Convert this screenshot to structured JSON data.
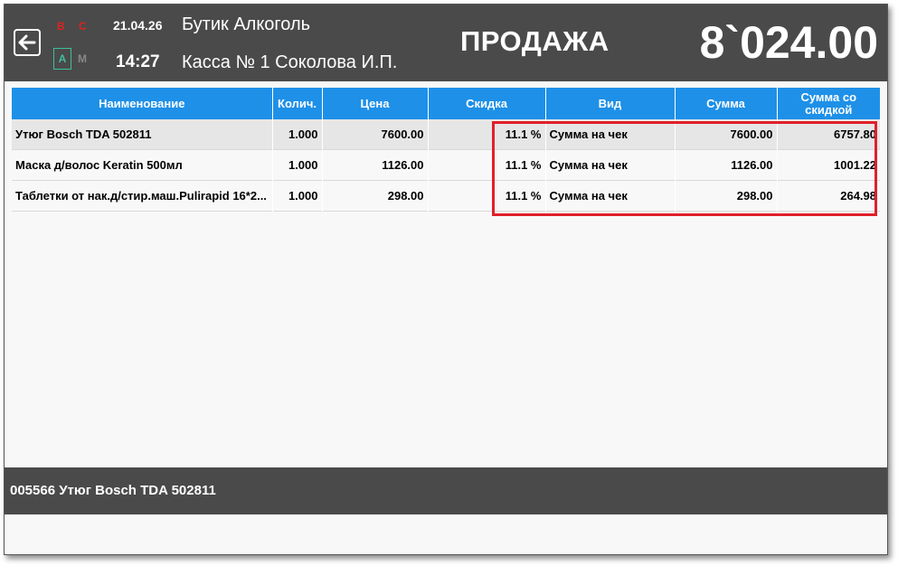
{
  "header": {
    "flags": {
      "b": "B",
      "c": "C",
      "a": "A",
      "m": "M"
    },
    "date": "21.04.26",
    "time": "14:27",
    "shop_name": "Бутик Алкоголь",
    "register": "Касса № 1 Соколова И.П.",
    "mode": "ПРОДАЖА",
    "total": "8`024.00"
  },
  "table": {
    "columns": [
      "Наименование",
      "Колич.",
      "Цена",
      "Скидка",
      "Вид",
      "Сумма",
      "Сумма со скидкой"
    ],
    "rows": [
      {
        "name": "Утюг Bosch TDA 502811",
        "qty": "1.000",
        "price": "7600.00",
        "discount": "11.1 %",
        "type": "Сумма на чек",
        "sum": "7600.00",
        "sum_discount": "6757.80"
      },
      {
        "name": "Маска д/волос Keratin 500мл",
        "qty": "1.000",
        "price": "1126.00",
        "discount": "11.1 %",
        "type": "Сумма на чек",
        "sum": "1126.00",
        "sum_discount": "1001.22"
      },
      {
        "name": "Таблетки от нак.д/стир.маш.Pulirapid 16*2...",
        "qty": "1.000",
        "price": "298.00",
        "discount": "11.1 %",
        "type": "Сумма на чек",
        "sum": "298.00",
        "sum_discount": "264.98"
      }
    ],
    "selected_row": 0
  },
  "status": {
    "text": "005566 Утюг Bosch TDA 502811"
  },
  "colors": {
    "header_bg": "#4a4a4a",
    "table_header": "#1e90e8",
    "highlight": "#e0202a",
    "flag_red": "#d22",
    "flag_green": "#3fbf9f"
  }
}
